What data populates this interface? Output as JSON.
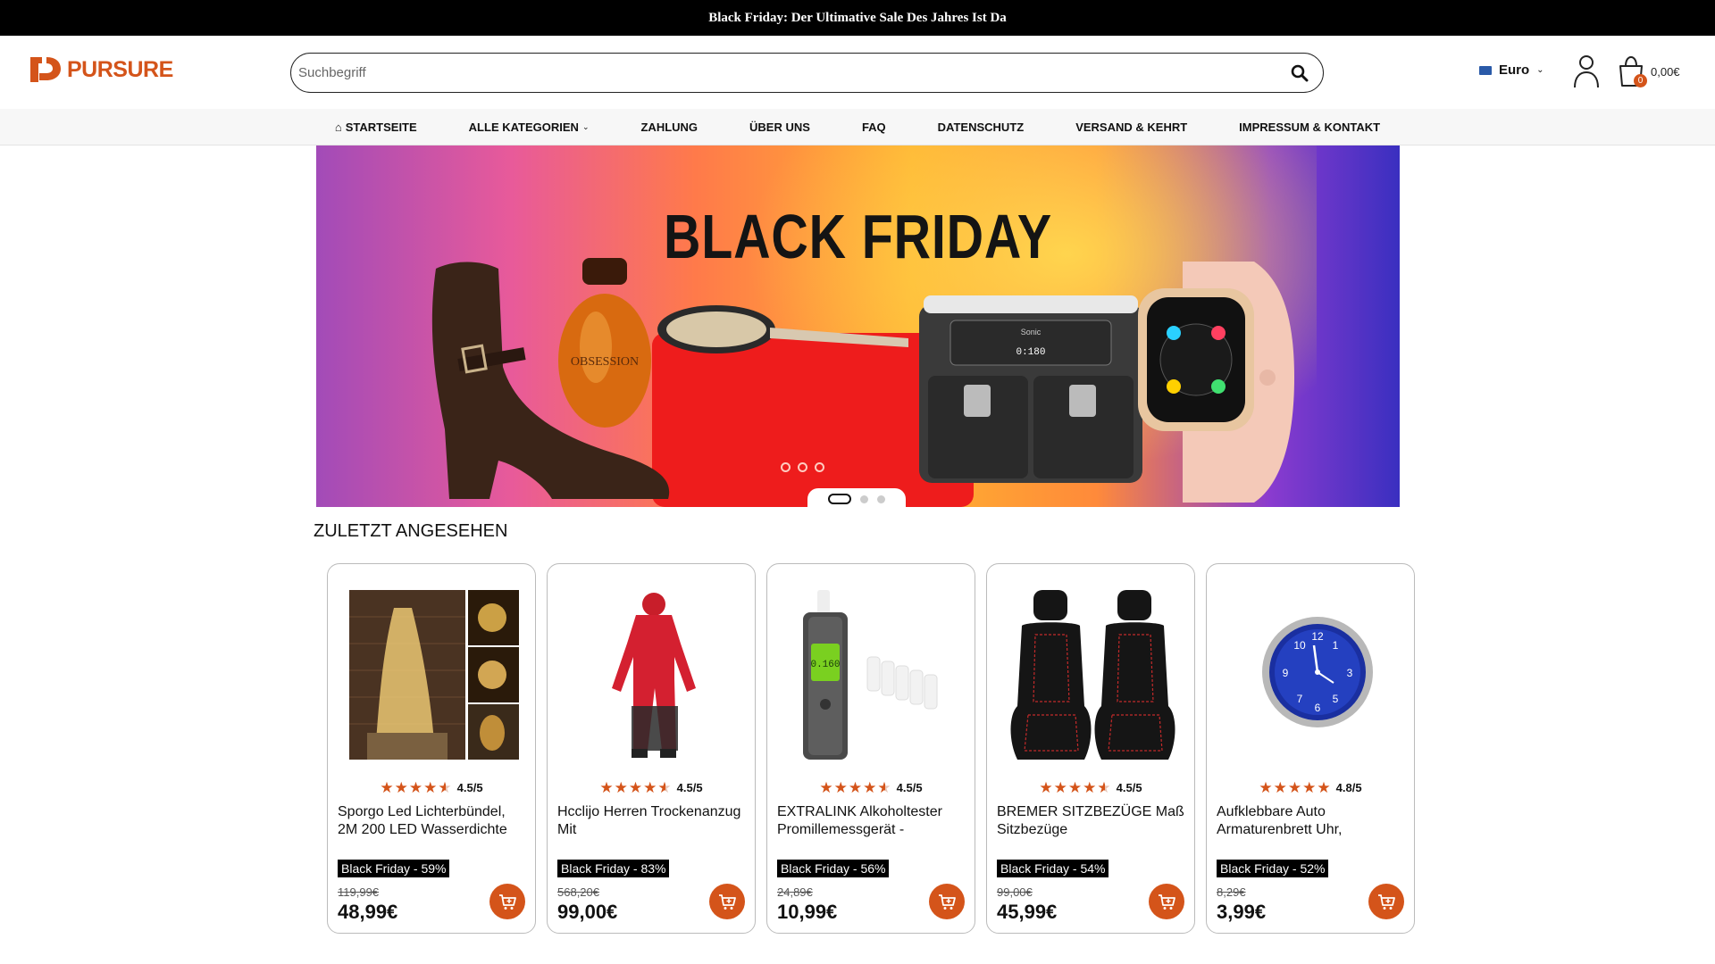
{
  "topbar": {
    "text": "Black Friday: Der Ultimative Sale Des Jahres Ist Da"
  },
  "logo": {
    "text": "PURSURE"
  },
  "search": {
    "placeholder": "Suchbegriff"
  },
  "currency": {
    "label": "Euro"
  },
  "cart": {
    "count": "0",
    "total": "0,00€"
  },
  "nav": {
    "items": [
      {
        "label": "STARTSEITE",
        "icon": "home-icon"
      },
      {
        "label": "ALLE KATEGORIEN",
        "icon": "chevron-down-icon"
      },
      {
        "label": "ZAHLUNG"
      },
      {
        "label": "ÜBER UNS"
      },
      {
        "label": "FAQ"
      },
      {
        "label": "DATENSCHUTZ"
      },
      {
        "label": "VERSAND & KEHRT"
      },
      {
        "label": "IMPRESSUM & KONTAKT"
      }
    ]
  },
  "banner": {
    "title": "BLACK FRIDAY",
    "perfume_label": "OBSESSION",
    "fryer_brand": "Sonic",
    "fryer_display": "0:180"
  },
  "recent": {
    "title": "ZULETZT ANGESEHEN",
    "products": [
      {
        "rating": "4.5/5",
        "stars": 4.5,
        "name": "Sporgo Led Lichterbündel, 2M 200 LED Wasserdichte",
        "deal": "Black Friday - 59%",
        "old_price": "119,99€",
        "price": "48,99€"
      },
      {
        "rating": "4.5/5",
        "stars": 4.5,
        "name": "Hcclijo Herren Trockenanzug Mit",
        "deal": "Black Friday - 83%",
        "old_price": "568,20€",
        "price": "99,00€"
      },
      {
        "rating": "4.5/5",
        "stars": 4.5,
        "name": "EXTRALINK Alkoholtester Promillemessgerät -",
        "deal": "Black Friday - 56%",
        "old_price": "24,89€",
        "price": "10,99€"
      },
      {
        "rating": "4.5/5",
        "stars": 4.5,
        "name": "BREMER SITZBEZÜGE Maß Sitzbezüge",
        "deal": "Black Friday - 54%",
        "old_price": "99,00€",
        "price": "45,99€"
      },
      {
        "rating": "4.8/5",
        "stars": 5,
        "name": "Aufklebbare Auto Armaturenbrett Uhr,",
        "deal": "Black Friday - 52%",
        "old_price": "8,29€",
        "price": "3,99€"
      }
    ]
  },
  "colors": {
    "accent": "#d4541a",
    "topbar_bg": "#000000"
  }
}
